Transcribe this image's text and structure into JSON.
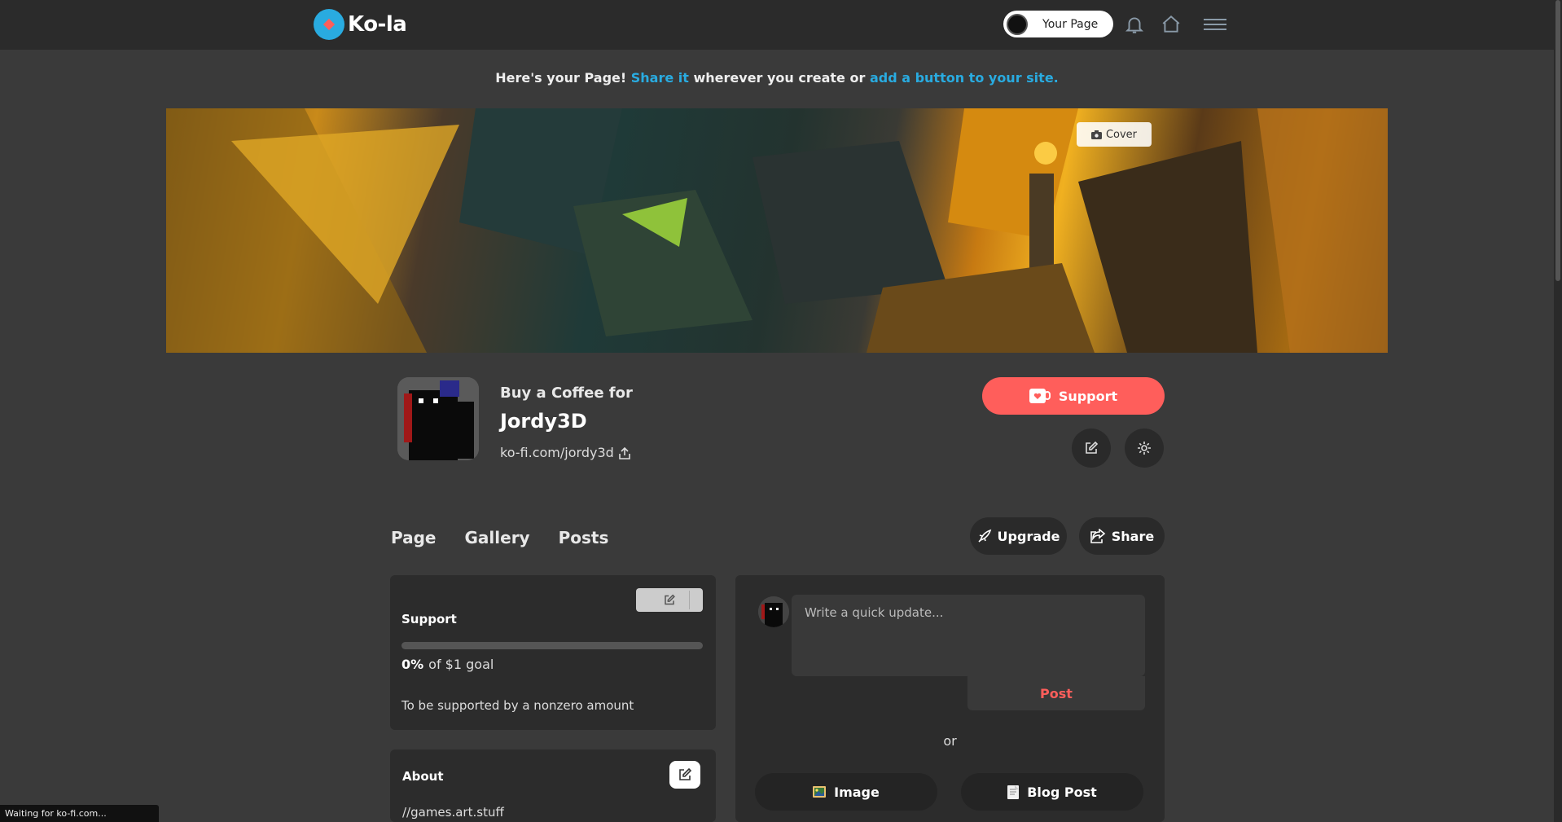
{
  "topbar": {
    "logo_text": "Ko-la",
    "your_page_label": "Your Page",
    "icons": [
      "bell-icon",
      "home-icon",
      "menu-icon"
    ]
  },
  "share_bar": {
    "prefix": "Here's your Page! ",
    "share_link": "Share it",
    "middle": " wherever you create or ",
    "button_link": "add a button to your site."
  },
  "cover": {
    "button_label": "Cover"
  },
  "profile": {
    "buy_for": "Buy a Coffee for",
    "name": "Jordy3D",
    "url": "ko-fi.com/jordy3d",
    "support_label": "Support"
  },
  "tabs": [
    {
      "label": "Page"
    },
    {
      "label": "Gallery"
    },
    {
      "label": "Posts"
    }
  ],
  "actions": {
    "upgrade_label": "Upgrade",
    "share_label": "Share"
  },
  "support_card": {
    "title": "Support",
    "percent": "0%",
    "progress_fraction": 0,
    "goal_text": "of $1 goal",
    "description": "To be supported by a nonzero amount"
  },
  "about_card": {
    "title": "About",
    "text": "//games.art.stuff"
  },
  "composer": {
    "placeholder": "Write a quick update...",
    "post_label": "Post",
    "or_text": "or",
    "image_label": "Image",
    "blog_label": "Blog Post"
  },
  "status_bar": {
    "text": "Waiting for ko-fi.com..."
  },
  "colors": {
    "accent_blue": "#29abe0",
    "support_red": "#ff5e5b",
    "background": "#3a3a3a",
    "topbar": "#2b2b2b"
  }
}
